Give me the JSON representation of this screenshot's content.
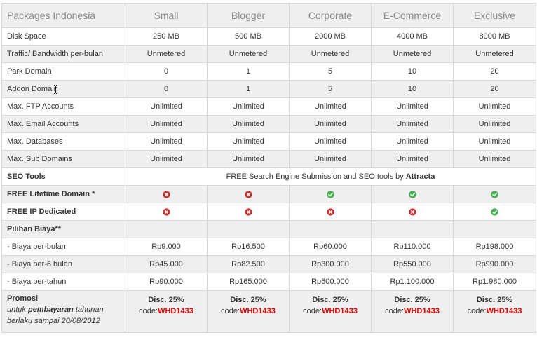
{
  "table": {
    "header": {
      "first": "Packages Indonesia",
      "packages": [
        "Small",
        "Blogger",
        "Corporate",
        "E-Commerce",
        "Exclusive"
      ]
    },
    "rows": [
      {
        "label": "Disk Space",
        "values": [
          "250 MB",
          "500 MB",
          "2000 MB",
          "4000 MB",
          "8000 MB"
        ]
      },
      {
        "label": "Traffic/ Bandwidth per-bulan",
        "values": [
          "Unmetered",
          "Unmetered",
          "Unmetered",
          "Unmetered",
          "Unmetered"
        ]
      },
      {
        "label": "Park Domain",
        "values": [
          "0",
          "1",
          "5",
          "10",
          "20"
        ]
      },
      {
        "label": "Addon Domain",
        "values": [
          "0",
          "1",
          "5",
          "10",
          "20"
        ]
      },
      {
        "label": "Max. FTP Accounts",
        "values": [
          "Unlimited",
          "Unlimited",
          "Unlimited",
          "Unlimited",
          "Unlimited"
        ]
      },
      {
        "label": "Max. Email Accounts",
        "values": [
          "Unlimited",
          "Unlimited",
          "Unlimited",
          "Unlimited",
          "Unlimited"
        ]
      },
      {
        "label": "Max. Databases",
        "values": [
          "Unlimited",
          "Unlimited",
          "Unlimited",
          "Unlimited",
          "Unlimited"
        ]
      },
      {
        "label": "Max. Sub Domains",
        "values": [
          "Unlimited",
          "Unlimited",
          "Unlimited",
          "Unlimited",
          "Unlimited"
        ]
      }
    ],
    "seo": {
      "label": "SEO Tools",
      "text": "FREE Search Engine Submission and SEO tools by ",
      "brand": "Attracta"
    },
    "free_domain": {
      "label": "FREE Lifetime Domain *",
      "icons": [
        "cross-icon",
        "cross-icon",
        "check-icon",
        "check-icon",
        "check-icon"
      ]
    },
    "free_ip": {
      "label": "FREE IP Dedicated",
      "icons": [
        "cross-icon",
        "cross-icon",
        "cross-icon",
        "cross-icon",
        "check-icon"
      ]
    },
    "pilihan": {
      "label": "Pilihan Biaya**"
    },
    "prices": [
      {
        "label": "- Biaya per-bulan",
        "values": [
          "Rp9.000",
          "Rp16.500",
          "Rp60.000",
          "Rp110.000",
          "Rp198.000"
        ]
      },
      {
        "label": "- Biaya per-6 bulan",
        "values": [
          "Rp45.000",
          "Rp82.500",
          "Rp300.000",
          "Rp550.000",
          "Rp990.000"
        ]
      },
      {
        "label": "- Biaya per-tahun",
        "values": [
          "Rp90.000",
          "Rp165.000",
          "Rp600.000",
          "Rp1.100.000",
          "Rp1.980.000"
        ]
      }
    ],
    "promo": {
      "title": "Promosi",
      "note_pre": "untuk ",
      "note_bold": "pembayaran",
      "note_post": " tahunan berlaku sampai 20/08/2012",
      "disc": "Disc. 25%",
      "code_prefix": "code:",
      "code": "WHD1433"
    }
  },
  "colors": {
    "check": "#3cb64a",
    "cross": "#d62b2b",
    "code": "#e00000",
    "stripe": "#efefef",
    "border": "#d6d6d6"
  }
}
